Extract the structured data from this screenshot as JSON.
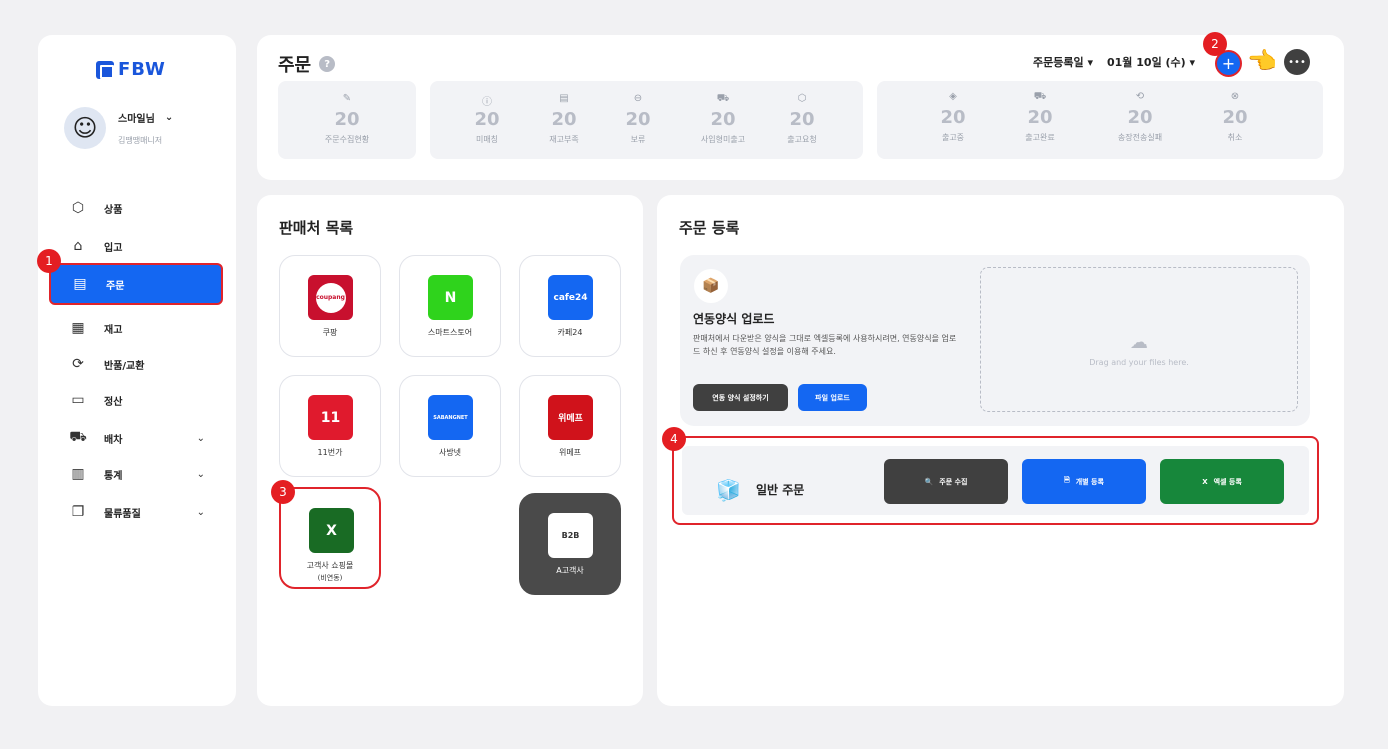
{
  "sidebar": {
    "logo_text": "FBW",
    "user_name": "스마일님",
    "user_role": "김땡땡매니저",
    "items": [
      {
        "label": "상품",
        "icon": "box-icon"
      },
      {
        "label": "입고",
        "icon": "warehouse-icon"
      },
      {
        "label": "주문",
        "icon": "order-icon"
      },
      {
        "label": "재고",
        "icon": "grid-icon"
      },
      {
        "label": "반품/교환",
        "icon": "refresh-icon"
      },
      {
        "label": "정산",
        "icon": "card-icon"
      },
      {
        "label": "배차",
        "icon": "car-icon"
      },
      {
        "label": "통계",
        "icon": "chart-icon"
      },
      {
        "label": "물류품질",
        "icon": "chat-icon"
      }
    ]
  },
  "markers": [
    "1",
    "2",
    "3",
    "4"
  ],
  "header": {
    "title": "주문",
    "date_type": "주문등록일",
    "date_value": "01월 10일 (수)",
    "stats_a": [
      {
        "value": "20",
        "label": "주문수집현황"
      }
    ],
    "stats_b": [
      {
        "value": "20",
        "label": "미매칭"
      },
      {
        "value": "20",
        "label": "재고부족"
      },
      {
        "value": "20",
        "label": "보류"
      },
      {
        "value": "20",
        "label": "사입형미출고"
      },
      {
        "value": "20",
        "label": "출고요청"
      }
    ],
    "stats_c": [
      {
        "value": "20",
        "label": "출고중"
      },
      {
        "value": "20",
        "label": "출고완료"
      },
      {
        "value": "20",
        "label": "송장전송실패"
      },
      {
        "value": "20",
        "label": "취소"
      }
    ]
  },
  "sellers": {
    "title": "판매처 목록",
    "items": [
      {
        "name": "쿠팡",
        "logo_text": "coupang",
        "color": "#c8102e"
      },
      {
        "name": "스마트스토어",
        "logo_text": "N",
        "color": "#2fd31c"
      },
      {
        "name": "카페24",
        "logo_text": "cafe24",
        "color": "#1467f2"
      },
      {
        "name": "11번가",
        "logo_text": "11",
        "color": "#e01a2d"
      },
      {
        "name": "사방넷",
        "logo_text": "SABANGNET",
        "color": "#1467f2"
      },
      {
        "name": "위메프",
        "logo_text": "위메프",
        "color": "#d0121b"
      },
      {
        "name": "고객사 쇼핑몰",
        "sub": "(비연동)",
        "logo_text": "X",
        "color": "#196b24"
      },
      {
        "name": "A고객사",
        "logo_text": "B2B",
        "color": "#4a4a4a"
      }
    ]
  },
  "order_reg": {
    "title": "주문 등록",
    "upload_title": "연동양식 업로드",
    "upload_desc": "판매처에서 다운받은 양식을 그대로 엑셀등록에 사용하시려면, 연동양식을 업로드 하신 후 연동양식 설정을 이용해 주세요.",
    "btn_settings": "연동 양식 설정하기",
    "btn_upload": "파일 업로드",
    "drop_text": "Drag and your files here.",
    "general_title": "일반 주문",
    "btn_collect": "주문 수집",
    "btn_individual": "개별 등록",
    "btn_excel": "엑셀 등록"
  }
}
